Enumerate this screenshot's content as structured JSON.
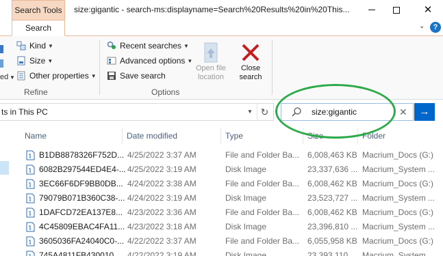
{
  "window": {
    "contextual_tab": "Search Tools",
    "title": "size:gigantic - search-ms:displayname=Search%20Results%20in%20This...",
    "minimize_glyph": "—",
    "close_glyph": "✕"
  },
  "ribbon_tabs": {
    "active": "Search",
    "help": "?"
  },
  "ribbon": {
    "refine": {
      "kind": "Kind",
      "size": "Size",
      "other_properties": "Other properties",
      "left_stub": "ed",
      "group_label": "Refine"
    },
    "options": {
      "recent_searches": "Recent searches",
      "advanced_options": "Advanced options",
      "save_search": "Save search",
      "open_file_location_1": "Open file",
      "open_file_location_2": "location",
      "close_search_1": "Close",
      "close_search_2": "search",
      "group_label": "Options"
    }
  },
  "address": {
    "text": "ts in This PC"
  },
  "search": {
    "value": "size:gigantic"
  },
  "columns": {
    "name": "Name",
    "date": "Date modified",
    "type": "Type",
    "size": "Size",
    "folder": "Folder"
  },
  "rows": [
    {
      "name": "B1DB8878326F752D...",
      "date": "4/25/2022 3:37 AM",
      "type": "File and Folder Ba...",
      "size": "6,008,463 KB",
      "folder": "Macrium_Docs (G:)"
    },
    {
      "name": "6082B297544ED4E4-...",
      "date": "4/25/2022 3:19 AM",
      "type": "Disk Image",
      "size": "23,337,636 ...",
      "folder": "Macrium_System ..."
    },
    {
      "name": "3EC66F6DF9BB0DB...",
      "date": "4/24/2022 3:38 AM",
      "type": "File and Folder Ba...",
      "size": "6,008,462 KB",
      "folder": "Macrium_Docs (G:)"
    },
    {
      "name": "79079B071B360C38-...",
      "date": "4/24/2022 3:19 AM",
      "type": "Disk Image",
      "size": "23,523,727 ...",
      "folder": "Macrium_System ..."
    },
    {
      "name": "1DAFCD72EA137E8...",
      "date": "4/23/2022 3:36 AM",
      "type": "File and Folder Ba...",
      "size": "6,008,462 KB",
      "folder": "Macrium_Docs (G:)"
    },
    {
      "name": "4C45809EBAC4FA11...",
      "date": "4/23/2022 3:18 AM",
      "type": "Disk Image",
      "size": "23,396,810 ...",
      "folder": "Macrium_System ..."
    },
    {
      "name": "3605036FA24040C0-...",
      "date": "4/22/2022 3:37 AM",
      "type": "File and Folder Ba...",
      "size": "6,055,958 KB",
      "folder": "Macrium_Docs (G:)"
    },
    {
      "name": "745A4811FB430010...",
      "date": "4/22/2022 3:19 AM",
      "type": "Disk Image",
      "size": "23,393,110 ...",
      "folder": "Macrium_System ..."
    }
  ],
  "colors": {
    "accent": "#0066cc",
    "context_tab": "#f7d9c3",
    "annotation": "#2eaa4a"
  }
}
